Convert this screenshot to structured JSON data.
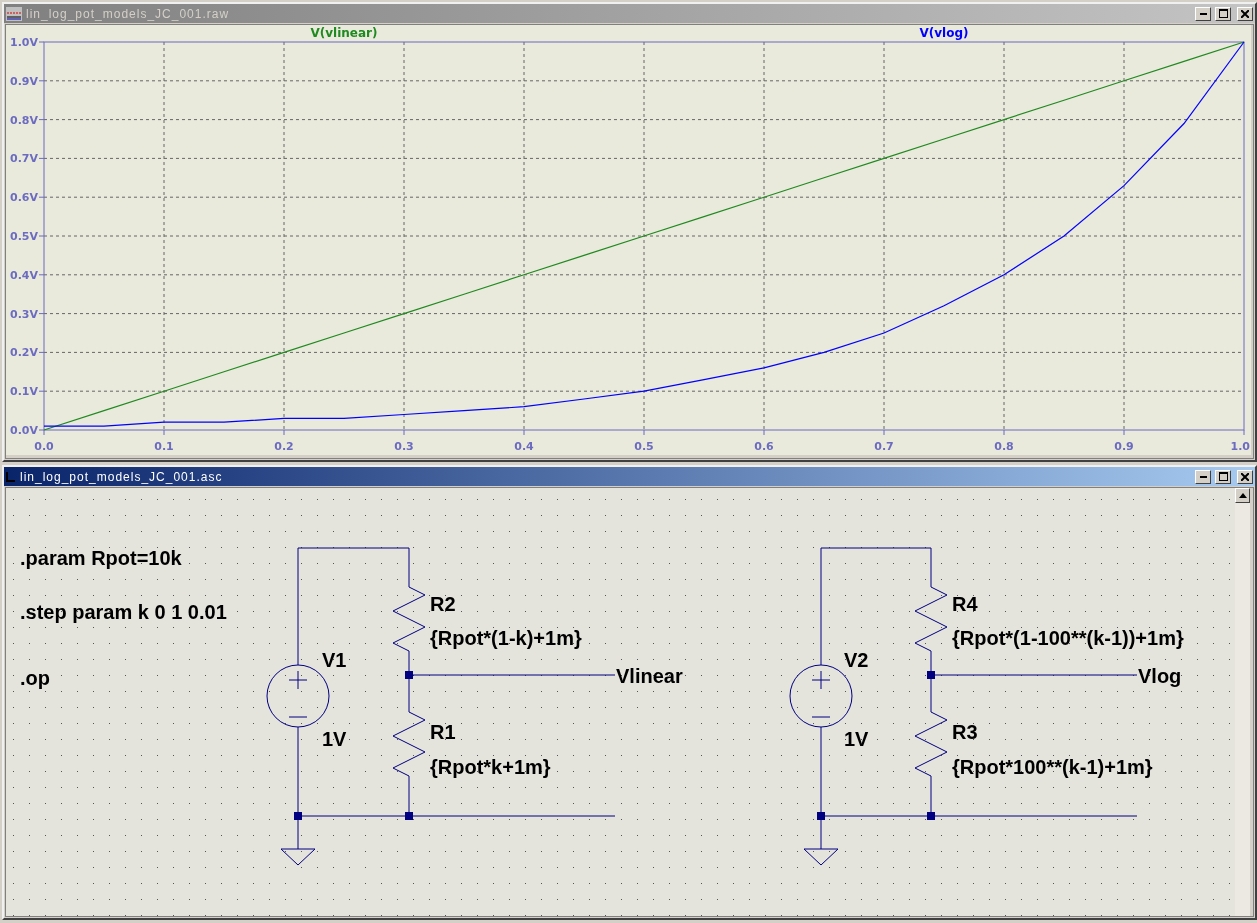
{
  "plot_window": {
    "title": "lin_log_pot_models_JC_001.raw",
    "active": false,
    "chart_data": {
      "type": "line",
      "x": [
        0,
        0.05,
        0.1,
        0.15,
        0.2,
        0.25,
        0.3,
        0.35,
        0.4,
        0.45,
        0.5,
        0.55,
        0.6,
        0.65,
        0.7,
        0.75,
        0.8,
        0.85,
        0.9,
        0.95,
        1
      ],
      "series": [
        {
          "name": "V(vlinear)",
          "color": "#1f8a1f",
          "values": [
            0,
            0.05,
            0.1,
            0.15,
            0.2,
            0.25,
            0.3,
            0.35,
            0.4,
            0.45,
            0.5,
            0.55,
            0.6,
            0.65,
            0.7,
            0.75,
            0.8,
            0.85,
            0.9,
            0.95,
            1
          ]
        },
        {
          "name": "V(vlog)",
          "color": "#0000ff",
          "values": [
            0.01,
            0.01,
            0.02,
            0.02,
            0.03,
            0.03,
            0.04,
            0.05,
            0.06,
            0.08,
            0.1,
            0.13,
            0.16,
            0.2,
            0.25,
            0.32,
            0.4,
            0.5,
            0.63,
            0.79,
            1
          ]
        }
      ],
      "xlim": [
        0,
        1
      ],
      "ylim": [
        0,
        1
      ],
      "grid": true,
      "xticks": [
        {
          "value": 0,
          "label": "0.0"
        },
        {
          "value": 0.1,
          "label": "0.1"
        },
        {
          "value": 0.2,
          "label": "0.2"
        },
        {
          "value": 0.3,
          "label": "0.3"
        },
        {
          "value": 0.4,
          "label": "0.4"
        },
        {
          "value": 0.5,
          "label": "0.5"
        },
        {
          "value": 0.6,
          "label": "0.6"
        },
        {
          "value": 0.7,
          "label": "0.7"
        },
        {
          "value": 0.8,
          "label": "0.8"
        },
        {
          "value": 0.9,
          "label": "0.9"
        },
        {
          "value": 1,
          "label": "1.0"
        }
      ],
      "yticks": [
        {
          "value": 0,
          "label": "0.0V"
        },
        {
          "value": 0.1,
          "label": "0.1V"
        },
        {
          "value": 0.2,
          "label": "0.2V"
        },
        {
          "value": 0.3,
          "label": "0.3V"
        },
        {
          "value": 0.4,
          "label": "0.4V"
        },
        {
          "value": 0.5,
          "label": "0.5V"
        },
        {
          "value": 0.6,
          "label": "0.6V"
        },
        {
          "value": 0.7,
          "label": "0.7V"
        },
        {
          "value": 0.8,
          "label": "0.8V"
        },
        {
          "value": 0.9,
          "label": "0.9V"
        },
        {
          "value": 1,
          "label": "1.0V"
        }
      ]
    }
  },
  "schematic_window": {
    "title": "lin_log_pot_models_JC_001.asc",
    "active": true,
    "directives": [
      ".param Rpot=10k",
      ".step param k 0 1 0.01",
      ".op"
    ],
    "circuits": [
      {
        "source": {
          "name": "V1",
          "value": "1V"
        },
        "top_resistor": {
          "name": "R2",
          "value": "{Rpot*(1-k)+1m}"
        },
        "bottom_resistor": {
          "name": "R1",
          "value": "{Rpot*k+1m}"
        },
        "net_label": "Vlinear"
      },
      {
        "source": {
          "name": "V2",
          "value": "1V"
        },
        "top_resistor": {
          "name": "R4",
          "value": "{Rpot*(1-100**(k-1))+1m}"
        },
        "bottom_resistor": {
          "name": "R3",
          "value": "{Rpot*100**(k-1)+1m}"
        },
        "net_label": "Vlog"
      }
    ]
  }
}
